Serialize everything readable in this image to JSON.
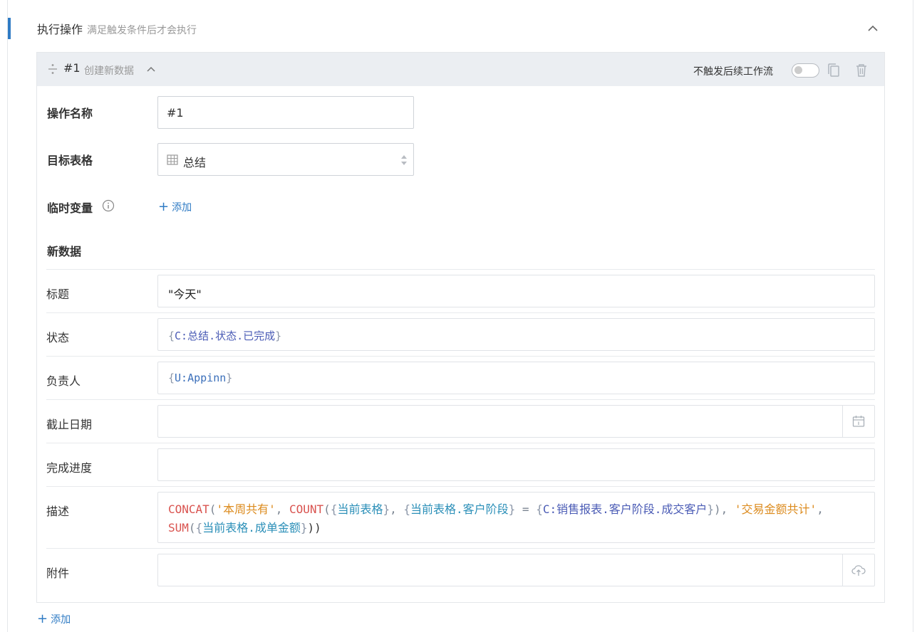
{
  "section": {
    "title": "执行操作",
    "subtitle": "满足触发条件后才会执行",
    "icons": {
      "collapse": "chevron-up-icon"
    }
  },
  "operation": {
    "number": "#1",
    "type": "创建新数据",
    "no_trigger_label": "不触发后续工作流",
    "no_trigger_enabled": false,
    "icons": {
      "drag": "drag-handle-icon",
      "expand": "chevron-up-icon",
      "copy": "copy-icon",
      "delete": "trash-icon"
    }
  },
  "form": {
    "name_label": "操作名称",
    "name_value": "#1",
    "target_label": "目标表格",
    "target_value": "总结",
    "temp_var_label": "临时变量",
    "temp_var_add": "添加",
    "new_data_label": "新数据"
  },
  "fields": {
    "title": {
      "label": "标题",
      "value": "\"今天\""
    },
    "status": {
      "label": "状态",
      "open": "{",
      "ref": "C:总结.状态.已完成",
      "close": "}"
    },
    "owner": {
      "label": "负责人",
      "open": "{",
      "ref": "U:Appinn",
      "close": "}"
    },
    "deadline": {
      "label": "截止日期",
      "value": "",
      "icon": "calendar-icon"
    },
    "progress": {
      "label": "完成进度",
      "value": ""
    },
    "description": {
      "label": "描述",
      "tokens": [
        {
          "text": "CONCAT",
          "style": "fn"
        },
        {
          "text": "(",
          "style": "op"
        },
        {
          "text": "'本周共有'",
          "style": "str"
        },
        {
          "text": ", ",
          "style": "op"
        },
        {
          "text": "COUNT",
          "style": "fn"
        },
        {
          "text": "(",
          "style": "op"
        },
        {
          "text": "{",
          "style": "brace"
        },
        {
          "text": "当前表格",
          "style": "teal"
        },
        {
          "text": "}",
          "style": "brace"
        },
        {
          "text": ", ",
          "style": "op"
        },
        {
          "text": "{",
          "style": "brace"
        },
        {
          "text": "当前表格.客户阶段",
          "style": "teal"
        },
        {
          "text": "}",
          "style": "brace"
        },
        {
          "text": " = ",
          "style": "op"
        },
        {
          "text": "{",
          "style": "brace"
        },
        {
          "text": "C:销售报表.客户阶段.成交客户",
          "style": "indigo"
        },
        {
          "text": "}",
          "style": "brace"
        },
        {
          "text": "), ",
          "style": "op"
        },
        {
          "text": "'交易金额共计'",
          "style": "str"
        },
        {
          "text": ", ",
          "style": "op"
        },
        {
          "text": "SUM",
          "style": "fn"
        },
        {
          "text": "(",
          "style": "op"
        },
        {
          "text": "{",
          "style": "brace"
        },
        {
          "text": "当前表格.成单金额",
          "style": "teal"
        },
        {
          "text": "}",
          "style": "brace"
        },
        {
          "text": "))",
          "style": "plain"
        }
      ]
    },
    "attachment": {
      "label": "附件",
      "value": "",
      "icon": "upload-cloud-icon"
    }
  },
  "footer": {
    "add_label": "添加"
  },
  "colors": {
    "accent": "#2f7bc4",
    "function": "#d9534f",
    "string": "#dc8b1e",
    "field_ref": "#2b8fb8",
    "option_ref": "#4a5bb5"
  }
}
